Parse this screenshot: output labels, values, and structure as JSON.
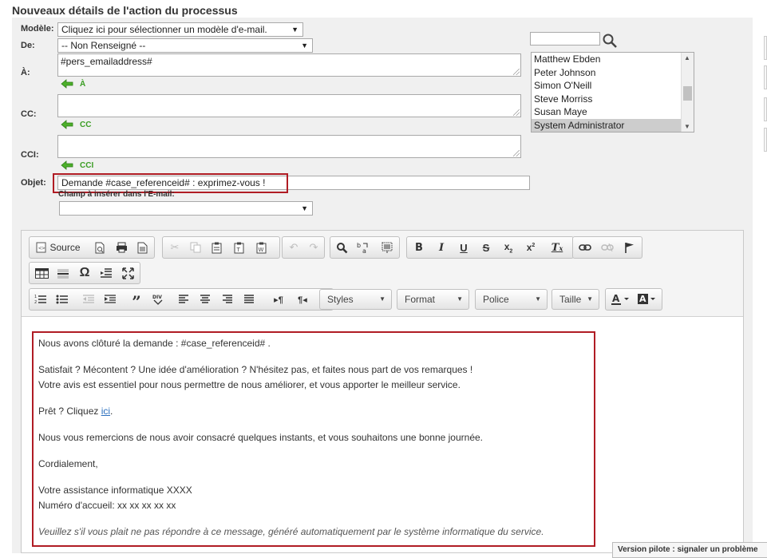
{
  "title": "Nouveaux détails de l'action du processus",
  "form": {
    "modele_label": "Modèle:",
    "modele_value": "Cliquez ici pour sélectionner un modèle d'e-mail.",
    "de_label": "De:",
    "de_value": "-- Non Renseigné --",
    "a_label": "À:",
    "a_value": "#pers_emailaddress#",
    "a_add": "À",
    "cc_label": "CC:",
    "cc_value": "",
    "cc_add": "CC",
    "cci_label": "CCI:",
    "cci_value": "",
    "cci_add": "CCI",
    "objet_label": "Objet:",
    "objet_value": "Demande #case_referenceid# : exprimez-vous !",
    "champ_label": "Champ à insérer dans l'E-mail:",
    "champ_value": ""
  },
  "recipients": {
    "search_value": "",
    "items": [
      "Matthew Ebden",
      "Peter Johnson",
      "Simon O'Neill",
      "Steve Morriss",
      "Susan Maye",
      "System Administrator"
    ],
    "selected": "System Administrator"
  },
  "toolbar": {
    "source_label": "Source",
    "styles": "Styles",
    "format": "Format",
    "police": "Police",
    "taille": "Taille",
    "bold": "B",
    "italic": "I",
    "underline": "U",
    "strike": "S"
  },
  "body": {
    "line1": "Nous avons clôturé la demande  : #case_referenceid# .",
    "line2": "Satisfait ? Mécontent ? Une idée d'amélioration ? N'hésitez pas, et faites nous part de vos remarques !",
    "line3": "Votre avis est essentiel pour nous permettre de nous améliorer, et vous apporter le meilleur service.",
    "line4_prefix": "Prêt ? Cliquez ",
    "line4_link": "ici",
    "line4_suffix": ".",
    "line5": "Nous vous remercions de nous avoir consacré quelques instants, et vous souhaitons une bonne journée.",
    "line6": "Cordialement,",
    "line7": "Votre assistance informatique XXXX",
    "line8": "Numéro d'accueil: xx xx xx xx xx",
    "line9": "Veuillez s'il vous plait ne pas répondre à ce message, généré automatiquement par le système informatique du service."
  },
  "tooltip": "Version pilote : signaler un problème",
  "colors": {
    "accent_red": "#b01c24",
    "add_green": "#3a9d23",
    "link_blue": "#2a6ebd"
  }
}
